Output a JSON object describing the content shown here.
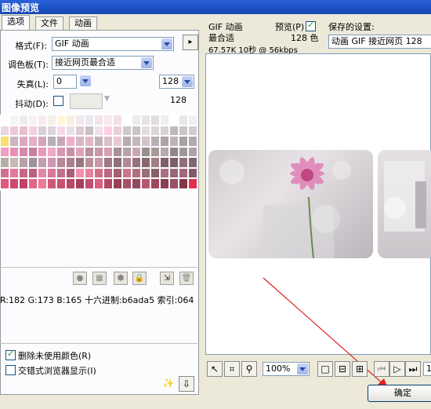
{
  "window": {
    "title": "图像预览"
  },
  "tabs": [
    "选项",
    "文件",
    "动画"
  ],
  "options": {
    "format_label": "格式(F):",
    "format_value": "GIF 动画",
    "palette_label": "调色板(T):",
    "palette_value": "接近网页最合适",
    "loss_label": "失真(L):",
    "loss_value": "0",
    "colors_value": "128",
    "colors_count": "128",
    "dither_label": "抖动(D):",
    "arrow_button": "▸"
  },
  "palette_info": "R:182 G:173 B:165 十六进制:b6ada5 索引:064",
  "checkboxes": {
    "remove_unused": "删除未使用颜色(R)",
    "interlaced": "交错式浏览器显示(I)"
  },
  "preview_info": {
    "format": "GIF 动画",
    "palette": "最合适",
    "size_time": "67.57K  10秒 @ 56kbps",
    "preview_label": "预览(P)",
    "colors": "128 色",
    "saved_settings_label": "保存的设置:",
    "saved_settings_value": "动画 GIF 接近网页 128"
  },
  "toolbar": {
    "zoom_value": "100%",
    "frame_partial": "1"
  },
  "buttons": {
    "ok": "确定"
  },
  "colors": {
    "title_bar": "#1c4fc4",
    "arrow": "#e02020"
  }
}
